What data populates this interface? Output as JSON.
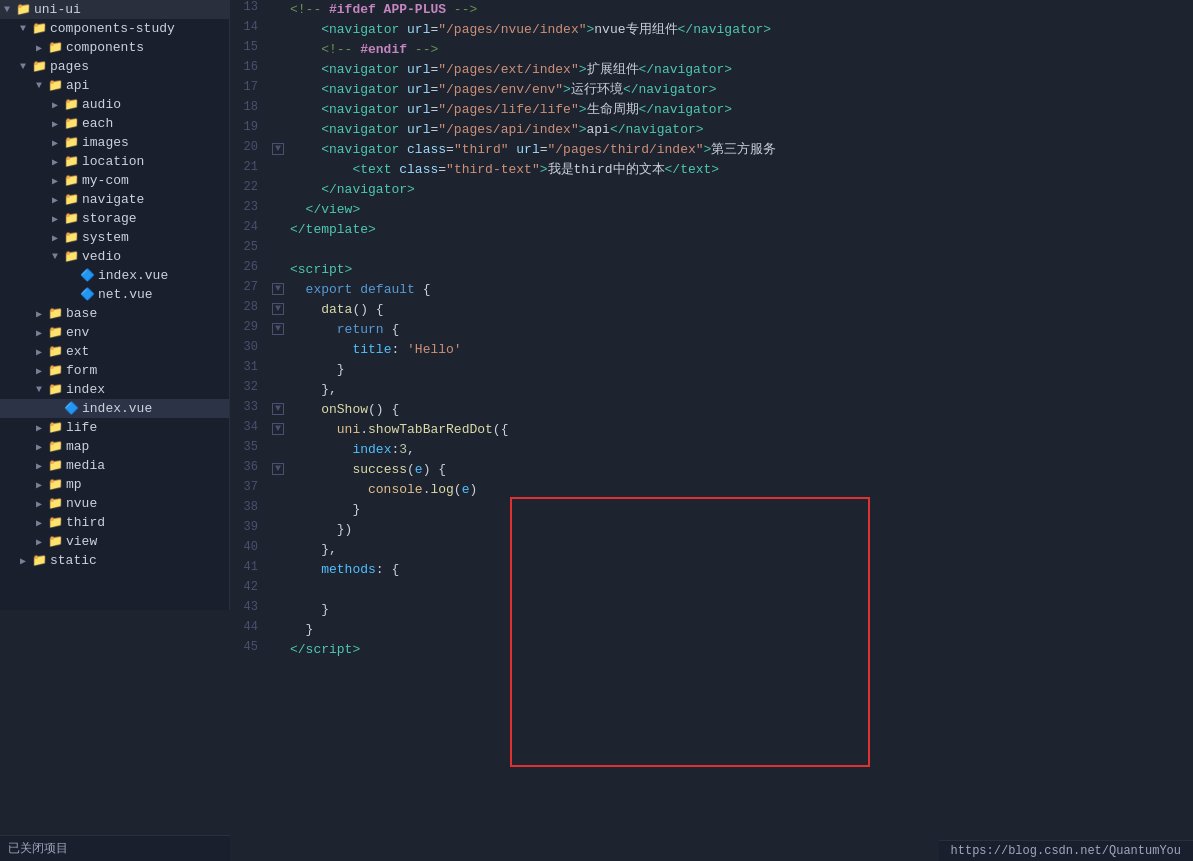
{
  "sidebar": {
    "items": [
      {
        "id": "uni-ui",
        "label": "uni-ui",
        "type": "root",
        "indent": 0,
        "arrow": "▼",
        "expanded": true
      },
      {
        "id": "components-study",
        "label": "components-study",
        "type": "folder",
        "indent": 1,
        "arrow": "▼",
        "expanded": true
      },
      {
        "id": "components",
        "label": "components",
        "type": "folder",
        "indent": 2,
        "arrow": "▶",
        "expanded": false
      },
      {
        "id": "pages",
        "label": "pages",
        "type": "folder",
        "indent": 1,
        "arrow": "▼",
        "expanded": true
      },
      {
        "id": "api",
        "label": "api",
        "type": "folder",
        "indent": 2,
        "arrow": "▼",
        "expanded": true
      },
      {
        "id": "audio",
        "label": "audio",
        "type": "folder",
        "indent": 3,
        "arrow": "▶",
        "expanded": false
      },
      {
        "id": "each",
        "label": "each",
        "type": "folder",
        "indent": 3,
        "arrow": "▶",
        "expanded": false
      },
      {
        "id": "images",
        "label": "images",
        "type": "folder",
        "indent": 3,
        "arrow": "▶",
        "expanded": false
      },
      {
        "id": "location",
        "label": "location",
        "type": "folder",
        "indent": 3,
        "arrow": "▶",
        "expanded": false
      },
      {
        "id": "my-com",
        "label": "my-com",
        "type": "folder",
        "indent": 3,
        "arrow": "▶",
        "expanded": false
      },
      {
        "id": "navigate",
        "label": "navigate",
        "type": "folder",
        "indent": 3,
        "arrow": "▶",
        "expanded": false
      },
      {
        "id": "storage",
        "label": "storage",
        "type": "folder",
        "indent": 3,
        "arrow": "▶",
        "expanded": false
      },
      {
        "id": "system",
        "label": "system",
        "type": "folder",
        "indent": 3,
        "arrow": "▶",
        "expanded": false
      },
      {
        "id": "vedio",
        "label": "vedio",
        "type": "folder",
        "indent": 3,
        "arrow": "▼",
        "expanded": true
      },
      {
        "id": "index-vue-1",
        "label": "index.vue",
        "type": "file-vue",
        "indent": 4,
        "arrow": "",
        "expanded": false
      },
      {
        "id": "net-vue",
        "label": "net.vue",
        "type": "file-vue",
        "indent": 4,
        "arrow": "",
        "expanded": false
      },
      {
        "id": "base",
        "label": "base",
        "type": "folder",
        "indent": 2,
        "arrow": "▶",
        "expanded": false
      },
      {
        "id": "env",
        "label": "env",
        "type": "folder",
        "indent": 2,
        "arrow": "▶",
        "expanded": false
      },
      {
        "id": "ext",
        "label": "ext",
        "type": "folder",
        "indent": 2,
        "arrow": "▶",
        "expanded": false
      },
      {
        "id": "form",
        "label": "form",
        "type": "folder",
        "indent": 2,
        "arrow": "▶",
        "expanded": false
      },
      {
        "id": "index",
        "label": "index",
        "type": "folder",
        "indent": 2,
        "arrow": "▼",
        "expanded": true
      },
      {
        "id": "index-vue-2",
        "label": "index.vue",
        "type": "file-vue",
        "indent": 3,
        "arrow": "",
        "expanded": false,
        "active": true
      },
      {
        "id": "life",
        "label": "life",
        "type": "folder",
        "indent": 2,
        "arrow": "▶",
        "expanded": false
      },
      {
        "id": "map",
        "label": "map",
        "type": "folder",
        "indent": 2,
        "arrow": "▶",
        "expanded": false
      },
      {
        "id": "media",
        "label": "media",
        "type": "folder",
        "indent": 2,
        "arrow": "▶",
        "expanded": false
      },
      {
        "id": "mp",
        "label": "mp",
        "type": "folder",
        "indent": 2,
        "arrow": "▶",
        "expanded": false
      },
      {
        "id": "nvue",
        "label": "nvue",
        "type": "folder",
        "indent": 2,
        "arrow": "▶",
        "expanded": false
      },
      {
        "id": "third",
        "label": "third",
        "type": "folder",
        "indent": 2,
        "arrow": "▶",
        "expanded": false
      },
      {
        "id": "view",
        "label": "view",
        "type": "folder",
        "indent": 2,
        "arrow": "▶",
        "expanded": false
      },
      {
        "id": "static",
        "label": "static",
        "type": "folder",
        "indent": 1,
        "arrow": "▶",
        "expanded": false
      }
    ],
    "close_label": "已关闭项目"
  },
  "editor": {
    "lines": [
      {
        "num": 13,
        "fold": false,
        "content": "comment_ifdef_app_plus"
      },
      {
        "num": 14,
        "fold": false,
        "content": "nav_nvue"
      },
      {
        "num": 15,
        "fold": false,
        "content": "comment_endif"
      },
      {
        "num": 16,
        "fold": false,
        "content": "nav_ext"
      },
      {
        "num": 17,
        "fold": false,
        "content": "nav_env"
      },
      {
        "num": 18,
        "fold": false,
        "content": "nav_life"
      },
      {
        "num": 19,
        "fold": false,
        "content": "nav_api"
      },
      {
        "num": 20,
        "fold": true,
        "content": "nav_third"
      },
      {
        "num": 21,
        "fold": false,
        "content": "text_third"
      },
      {
        "num": 22,
        "fold": false,
        "content": "close_nav"
      },
      {
        "num": 23,
        "fold": false,
        "content": "close_view"
      },
      {
        "num": 24,
        "fold": false,
        "content": "close_template"
      },
      {
        "num": 25,
        "fold": false,
        "content": "empty"
      },
      {
        "num": 26,
        "fold": false,
        "content": "script_tag"
      },
      {
        "num": 27,
        "fold": true,
        "content": "export_default"
      },
      {
        "num": 28,
        "fold": true,
        "content": "data_func"
      },
      {
        "num": 29,
        "fold": true,
        "content": "return_open"
      },
      {
        "num": 30,
        "fold": false,
        "content": "title_hello"
      },
      {
        "num": 31,
        "fold": false,
        "content": "close_brace_2"
      },
      {
        "num": 32,
        "fold": false,
        "content": "close_brace_comma"
      },
      {
        "num": 33,
        "fold": true,
        "content": "onShow_open"
      },
      {
        "num": 34,
        "fold": true,
        "content": "uni_showTabBar"
      },
      {
        "num": 35,
        "fold": false,
        "content": "index_3"
      },
      {
        "num": 36,
        "fold": true,
        "content": "success_e"
      },
      {
        "num": 37,
        "fold": false,
        "content": "console_log"
      },
      {
        "num": 38,
        "fold": false,
        "content": "close_brace_3"
      },
      {
        "num": 39,
        "fold": false,
        "content": "close_paren_brace"
      },
      {
        "num": 40,
        "fold": false,
        "content": "close_brace_comma2"
      },
      {
        "num": 41,
        "fold": false,
        "content": "methods_open"
      },
      {
        "num": 42,
        "fold": false,
        "content": "empty"
      },
      {
        "num": 43,
        "fold": false,
        "content": "close_brace_4"
      },
      {
        "num": 44,
        "fold": false,
        "content": "close_brace_5"
      },
      {
        "num": 45,
        "fold": false,
        "content": "script_close"
      }
    ]
  },
  "statusbar": {
    "url": "https://blog.csdn.net/QuantumYou"
  }
}
